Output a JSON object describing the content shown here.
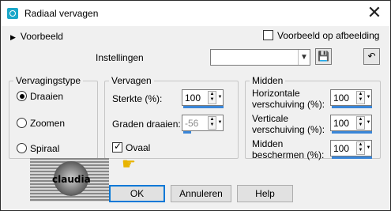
{
  "window": {
    "title": "Radiaal vervagen",
    "close_glyph": "✕"
  },
  "preview": {
    "label": "Voorbeeld",
    "on_image_label": "Voorbeeld op afbeelding",
    "on_image_checked": false
  },
  "settings": {
    "label": "Instellingen",
    "value": ""
  },
  "vervagingstype": {
    "title": "Vervagingstype",
    "options": [
      {
        "label": "Draaien",
        "selected": true
      },
      {
        "label": "Zoomen",
        "selected": false
      },
      {
        "label": "Spiraal",
        "selected": false
      }
    ]
  },
  "vervagen": {
    "title": "Vervagen",
    "sterkte_label": "Sterkte (%):",
    "sterkte_value": "100",
    "graden_label": "Graden draaien:",
    "graden_value": "-56",
    "ovaal_label": "Ovaal",
    "ovaal_checked": true
  },
  "midden": {
    "title": "Midden",
    "horiz_label_1": "Horizontale",
    "horiz_label_2": "verschuiving (%):",
    "horiz_value": "100",
    "vert_label_1": "Verticale",
    "vert_label_2": "verschuiving (%):",
    "vert_value": "100",
    "bescherm_label_1": "Midden",
    "bescherm_label_2": "beschermen (%):",
    "bescherm_value": "100"
  },
  "buttons": {
    "ok": "OK",
    "cancel": "Annuleren",
    "help": "Help"
  },
  "watermark": {
    "text": "claudia"
  },
  "colors": {
    "accent": "#0078d7",
    "slider": "#3a86d8"
  }
}
